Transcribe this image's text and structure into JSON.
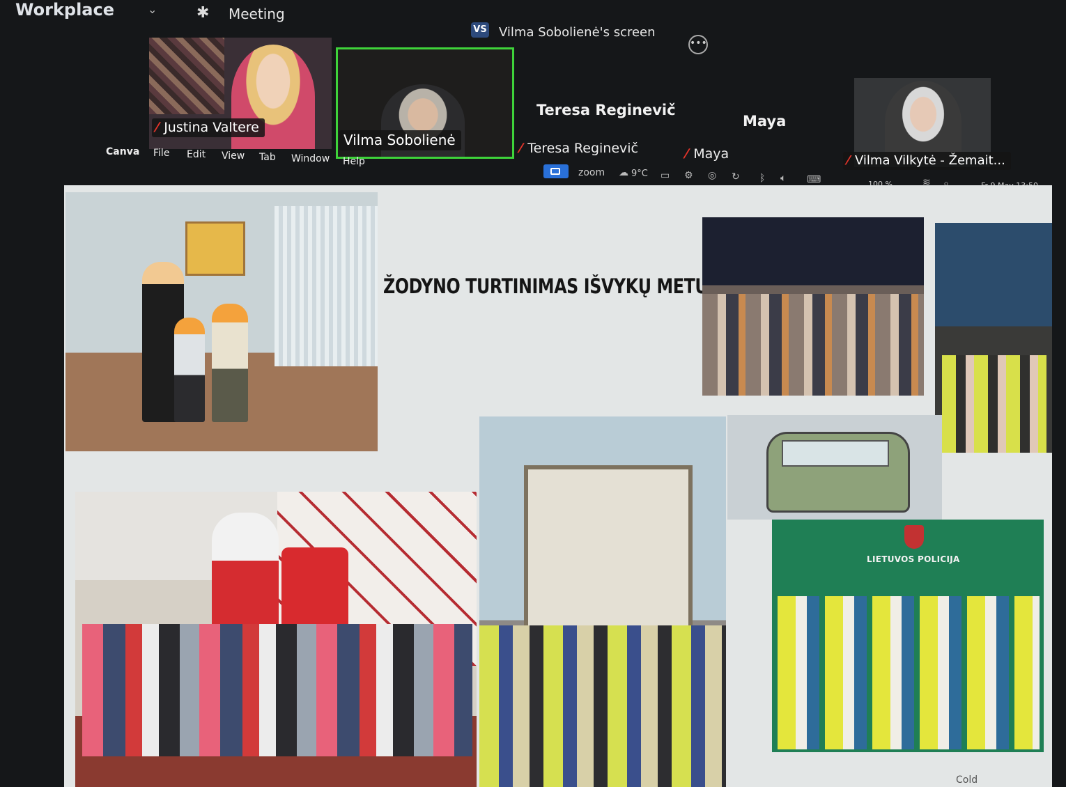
{
  "top_bar": {
    "app": "Workplace",
    "meeting": "Meeting",
    "share_badge": "VS",
    "share_label": "Vilma Sobolienė's screen",
    "more_icon": "more-icon"
  },
  "participants": {
    "justina": {
      "name": "Justina Valtere",
      "muted": true
    },
    "vilma": {
      "name": "Vilma Sobolienė",
      "active_speaker": true,
      "border_color": "#3ed33a"
    },
    "teresa": {
      "display_name": "Teresa Reginevič",
      "name": "Teresa Reginevič",
      "muted": true
    },
    "maya": {
      "display_name": "Maya",
      "name": "Maya",
      "muted": true
    },
    "vilka": {
      "name": "Vilma Vilkytė - Žemait...",
      "muted": true
    }
  },
  "mac_menu": {
    "apple": "",
    "items": [
      "Canva",
      "File",
      "Edit",
      "View",
      "Tab",
      "Window",
      "Help"
    ]
  },
  "status_bar": {
    "zoom": "zoom",
    "weather": "9°C",
    "battery": "100 %",
    "datetime": "Fr 9 May 13:50"
  },
  "slide": {
    "title": "ŽODYNO TURTINIMAS IŠVYKŲ METU",
    "police_label": "LIETUVOS POLICIJA"
  },
  "taskbar": {
    "weather": "Cold"
  },
  "colors": {
    "mic_off": "#e5342a",
    "zoom_blue": "#2970d8",
    "active_border": "#3ed33a"
  }
}
